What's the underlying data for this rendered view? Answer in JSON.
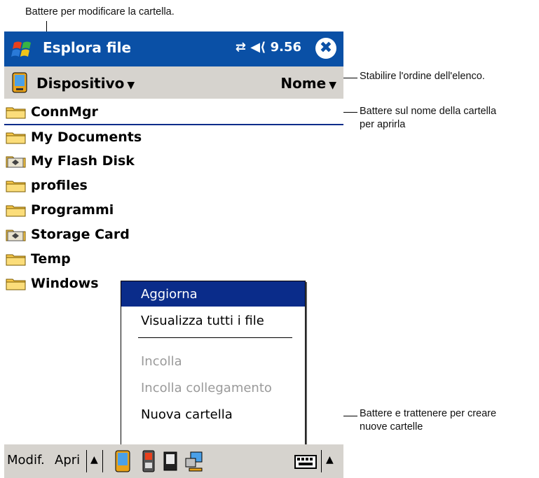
{
  "callouts": {
    "top": "Battere per modificare la cartella.",
    "sort": "Stabilire l'ordine dell'elenco.",
    "open_line1": "Battere sul nome della cartella",
    "open_line2": "per aprirla",
    "newfolder_line1": "Battere e trattenere per creare",
    "newfolder_line2": "nuove cartelle"
  },
  "titlebar": {
    "title": "Esplora file",
    "status": "⇄ ◀⟨ 9.56",
    "close_symbol": "✖"
  },
  "addressbar": {
    "location": "Dispositivo",
    "sort_by": "Nome",
    "caret": "▼"
  },
  "folders": [
    {
      "label": "ConnMgr",
      "icon": "folder-icon"
    },
    {
      "label": "My Documents",
      "icon": "folder-icon"
    },
    {
      "label": "My Flash Disk",
      "icon": "storage-icon"
    },
    {
      "label": "profiles",
      "icon": "folder-icon"
    },
    {
      "label": "Programmi",
      "icon": "folder-icon"
    },
    {
      "label": "Storage Card",
      "icon": "storage-icon"
    },
    {
      "label": "Temp",
      "icon": "folder-icon"
    },
    {
      "label": "Windows",
      "icon": "folder-icon"
    }
  ],
  "context_menu": {
    "refresh": "Aggiorna",
    "show_all": "Visualizza tutti i file",
    "paste": "Incolla",
    "paste_shortcut": "Incolla collegamento",
    "new_folder": "Nuova cartella"
  },
  "taskbar": {
    "edit": "Modif.",
    "open": "Apri",
    "up": "▲"
  },
  "colors": {
    "titlebar": "#0a50a6",
    "selection": "#0a2c8a",
    "bar_gray": "#d6d3ce"
  }
}
